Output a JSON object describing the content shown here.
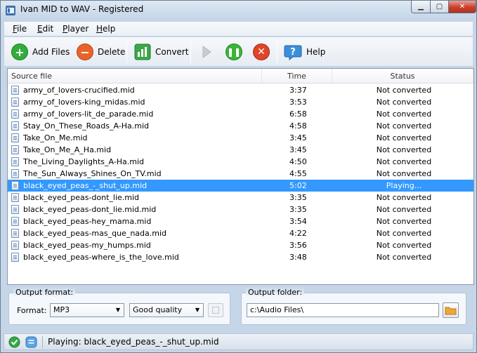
{
  "window": {
    "title": "Ivan MID to WAV - Registered"
  },
  "menu": [
    {
      "label": "File",
      "key": "F",
      "rest": "ile"
    },
    {
      "label": "Edit",
      "key": "E",
      "rest": "dit"
    },
    {
      "label": "Player",
      "key": "P",
      "rest": "layer"
    },
    {
      "label": "Help",
      "key": "H",
      "rest": "elp"
    }
  ],
  "toolbar": {
    "add_files": "Add Files",
    "delete": "Delete",
    "convert": "Convert",
    "help": "Help"
  },
  "colors": {
    "add_green": "#2fae3b",
    "delete_orange": "#e8632a",
    "pause_green": "#3cb43c",
    "stop_red": "#e0442a",
    "help_blue": "#3b8fd9",
    "selection": "#3399ff"
  },
  "list": {
    "headers": {
      "source": "Source file",
      "time": "Time",
      "status": "Status"
    },
    "rows": [
      {
        "file": "army_of_lovers-crucified.mid",
        "time": "3:37",
        "status": "Not converted"
      },
      {
        "file": "army_of_lovers-king_midas.mid",
        "time": "3:53",
        "status": "Not converted"
      },
      {
        "file": "army_of_lovers-lit_de_parade.mid",
        "time": "6:58",
        "status": "Not converted"
      },
      {
        "file": "Stay_On_These_Roads_A-Ha.mid",
        "time": "4:58",
        "status": "Not converted"
      },
      {
        "file": "Take_On_Me.mid",
        "time": "3:45",
        "status": "Not converted"
      },
      {
        "file": "Take_On_Me_A_Ha.mid",
        "time": "3:45",
        "status": "Not converted"
      },
      {
        "file": "The_Living_Daylights_A-Ha.mid",
        "time": "4:50",
        "status": "Not converted"
      },
      {
        "file": "The_Sun_Always_Shines_On_TV.mid",
        "time": "4:55",
        "status": "Not converted"
      },
      {
        "file": "black_eyed_peas_-_shut_up.mid",
        "time": "5:02",
        "status": "Playing...",
        "selected": true
      },
      {
        "file": "black_eyed_peas-dont_lie.mid",
        "time": "3:35",
        "status": "Not converted"
      },
      {
        "file": "black_eyed_peas-dont_lie.mid.mid",
        "time": "3:35",
        "status": "Not converted"
      },
      {
        "file": "black_eyed_peas-hey_mama.mid",
        "time": "3:54",
        "status": "Not converted"
      },
      {
        "file": "black_eyed_peas-mas_que_nada.mid",
        "time": "4:22",
        "status": "Not converted"
      },
      {
        "file": "black_eyed_peas-my_humps.mid",
        "time": "3:56",
        "status": "Not converted"
      },
      {
        "file": "black_eyed_peas-where_is_the_love.mid",
        "time": "3:48",
        "status": "Not converted"
      }
    ]
  },
  "output_format": {
    "legend": "Output format:",
    "format_label": "Format:",
    "format_value": "MP3",
    "quality_value": "Good quality"
  },
  "output_folder": {
    "legend": "Output folder:",
    "path": "c:\\Audio Files\\"
  },
  "status": {
    "text": "Playing: black_eyed_peas_-_shut_up.mid"
  }
}
